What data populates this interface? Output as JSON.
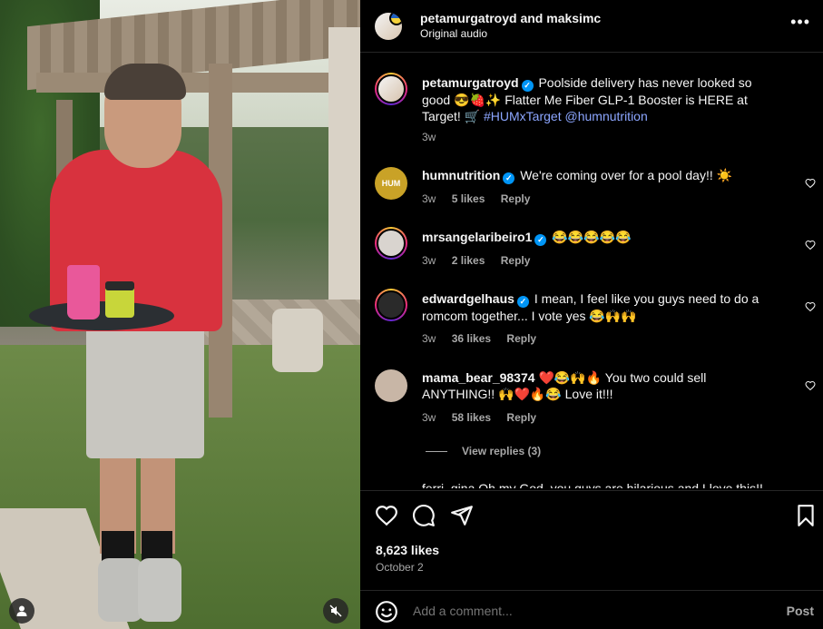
{
  "media": {
    "profile_icon": "person-icon",
    "mute_icon": "speaker-muted-icon"
  },
  "header": {
    "user1": "petamurgatroyd",
    "and": "and",
    "user2": "maksimc",
    "audio": "Original audio",
    "more_icon": "more-horizontal-icon"
  },
  "caption": {
    "username": "petamurgatroyd",
    "text_part1": "Poolside delivery has never looked so good 😎🍓✨ Flatter Me Fiber GLP-1 Booster is HERE at Target! 🛒 ",
    "hashtag": "#HUMxTarget",
    "mention": "@humnutrition",
    "time": "3w"
  },
  "comments": [
    {
      "username": "humnutrition",
      "verified": true,
      "text": "We're coming over for a pool day!! ☀️",
      "time": "3w",
      "likes": "5 likes",
      "reply": "Reply",
      "avatar_color": "#c9a227"
    },
    {
      "username": "mrsangelaribeiro1",
      "verified": true,
      "text": "😂😂😂😂😂",
      "time": "3w",
      "likes": "2 likes",
      "reply": "Reply",
      "avatar_color": "#d9d4cf"
    },
    {
      "username": "edwardgelhaus",
      "verified": true,
      "text": "I mean, I feel like you guys need to do a romcom together... I vote yes 😂🙌🙌",
      "time": "3w",
      "likes": "36 likes",
      "reply": "Reply",
      "avatar_color": "#2a2a2a"
    },
    {
      "username": "mama_bear_98374",
      "verified": false,
      "text": "❤️😂🙌🔥 You two could sell ANYTHING!! 🙌❤️🔥😂 Love it!!!",
      "time": "3w",
      "likes": "58 likes",
      "reply": "Reply",
      "avatar_color": "#c8b6a6"
    }
  ],
  "view_replies": "View replies (3)",
  "cut_comment": "ferri_gina Oh my God, you guys are hilarious and I love this!!",
  "actions": {
    "like_icon": "heart-icon",
    "comment_icon": "comment-icon",
    "share_icon": "send-icon",
    "save_icon": "bookmark-icon",
    "likes": "8,623 likes",
    "date": "October 2"
  },
  "add_comment": {
    "placeholder": "Add a comment...",
    "post": "Post",
    "emoji_icon": "emoji-icon"
  }
}
